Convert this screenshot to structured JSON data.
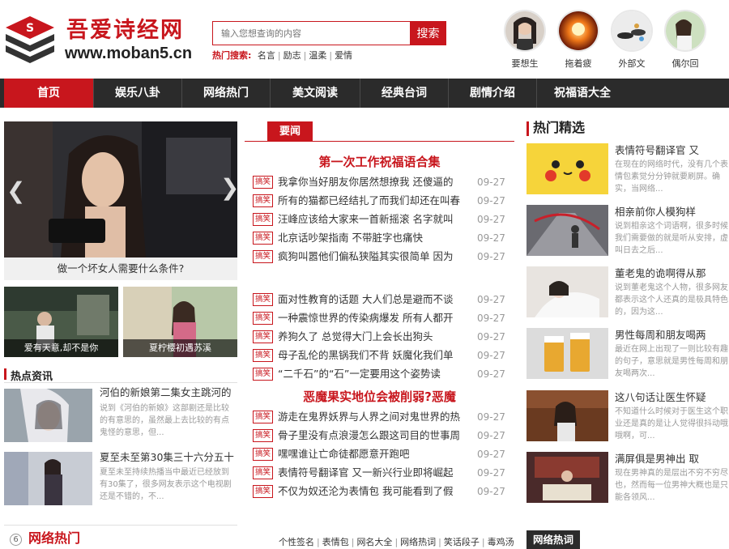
{
  "header": {
    "site_name": "吾爱诗经网",
    "site_url": "www.moban5.cn",
    "search_placeholder": "输入您想查询的内容",
    "search_button": "搜索",
    "hot_search_label": "热门搜索:",
    "hot_search_terms": [
      "名言",
      "励志",
      "温柔",
      "爱情"
    ],
    "users": [
      "要想生",
      "拖着疲",
      "外部文",
      "偶尔回"
    ]
  },
  "nav": [
    "首页",
    "娱乐八卦",
    "网络热门",
    "美文阅读",
    "经典台词",
    "剧情介绍",
    "祝福语大全"
  ],
  "left": {
    "slider_caption": "做一个坏女人需要什么条件?",
    "thumbs": [
      "爱有天意,却不是你",
      "夏柠樱初遇苏溪"
    ],
    "hot_news_title": "热点资讯",
    "news": [
      {
        "title": "河伯的新娘第二集女主跳河的",
        "desc": "说到《河伯的新娘》这部剧还是比较的有意思的，虽然最上去比较的有点鬼怪的意思，但..."
      },
      {
        "title": "夏至未至第30集三十六分五十",
        "desc": "夏至未至持续热播当中最近已经放到有30集了，很多网友表示这个电视剧还是不错的，不..."
      }
    ]
  },
  "middle": {
    "tab_label": "要闻",
    "headline_1": "第一次工作祝福语合集",
    "headline_2": "恶魔果实地位会被削弱?恶魔",
    "badge": "搞笑",
    "group_1": [
      {
        "title": "我拿你当好朋友你居然想撩我 还傻逼的",
        "date": "09-27"
      },
      {
        "title": "所有的猫都已经结扎了而我们却还在叫春",
        "date": "09-27"
      },
      {
        "title": "汪峰应该给大家来一首新摇滚 名字就叫",
        "date": "09-27"
      },
      {
        "title": "北京话吵架指南 不带脏字也痛快",
        "date": "09-27"
      },
      {
        "title": "疯狗叫嚣他们偏私狭隘其实很简单 因为",
        "date": "09-27"
      }
    ],
    "group_2": [
      {
        "title": "面对性教育的话题 大人们总是避而不谈",
        "date": "09-27"
      },
      {
        "title": "一种震惊世界的传染病爆发 所有人都开",
        "date": "09-27"
      },
      {
        "title": "养狗久了 总觉得大门上会长出狗头",
        "date": "09-27"
      },
      {
        "title": "母子乱伦的黑锅我们不背 妖魔化我们单",
        "date": "09-27"
      },
      {
        "title": "“二千石”的“石”一定要用这个姿势读",
        "date": "09-27"
      }
    ],
    "group_3": [
      {
        "title": "游走在鬼界妖界与人界之间对鬼世界的热",
        "date": "09-27"
      },
      {
        "title": "骨子里没有点浪漫怎么跟这司目的世事周",
        "date": "09-27"
      },
      {
        "title": "嘿嘿谁让亡命徒都愿意开跑吧",
        "date": "09-27"
      },
      {
        "title": "表情符号翻译官 又一新兴行业即将崛起",
        "date": "09-27"
      },
      {
        "title": "不仅为奴还沦为表情包 我可能看到了假",
        "date": "09-27"
      }
    ]
  },
  "right": {
    "title": "热门精选",
    "items": [
      {
        "title": "表情符号翻译官 又",
        "desc": "在现在的网络时代，没有几个表情包素觉分分钟就要刷屏。确实，当网络..."
      },
      {
        "title": "相亲前你人模狗样",
        "desc": "说到相亲这个词语啊，很多时候我们需要做的就是听从安排，虚叫日去之后..."
      },
      {
        "title": "董老鬼的诡啊得从那",
        "desc": "说到董老鬼这个人物，很多网友都表示这个人还真的是极具特色的，因为这..."
      },
      {
        "title": "男性每周和朋友喝两",
        "desc": "最近在网上出现了一则比较有趣的句子，意思就是男性每周和朋友喝两次..."
      },
      {
        "title": "这八句话让医生怀疑",
        "desc": "不知道什么时候对于医生这个职业还是真的是让人觉得很抖动哦哦啊，可..."
      },
      {
        "title": "满屏俱是男神出 取",
        "desc": "现在男神真的是层出不穷不穷尽也，然而每一位男神大概也是只能各领风..."
      }
    ]
  },
  "bottom": {
    "number": "6",
    "title": "网络热门",
    "links": [
      "个性签名",
      "表情包",
      "网名大全",
      "网络热词",
      "笑话段子",
      "毒鸡汤"
    ],
    "right_title": "网络热词"
  }
}
